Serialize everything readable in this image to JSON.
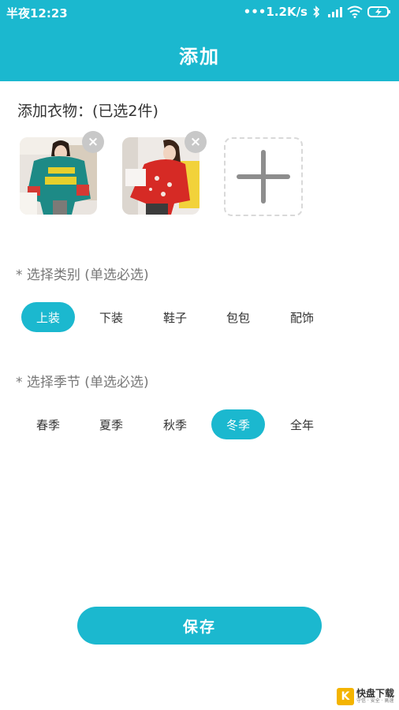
{
  "status_bar": {
    "time": "半夜12:23",
    "network_speed": "•••1.2K/s",
    "icons": [
      "bluetooth-icon",
      "hd-signal-icon",
      "wifi-icon",
      "battery-charging-icon"
    ]
  },
  "header": {
    "title": "添加"
  },
  "photos": {
    "section_title": "添加衣物：(已选2件)",
    "items": [
      {
        "alt": "green letter sweater photo",
        "remove_label": "×"
      },
      {
        "alt": "red floral sweater photo",
        "remove_label": "×"
      }
    ],
    "add_icon": "plus-icon"
  },
  "category": {
    "label": "* 选择类别 (单选必选)",
    "options": [
      "上装",
      "下装",
      "鞋子",
      "包包",
      "配饰"
    ],
    "selected": "上装"
  },
  "season": {
    "label": "* 选择季节 (单选必选)",
    "options": [
      "春季",
      "夏季",
      "秋季",
      "冬季",
      "全年"
    ],
    "selected": "冬季"
  },
  "actions": {
    "save_label": "保存"
  },
  "watermark": {
    "mark": "K",
    "title": "快盘下载",
    "subtitle": "守信 · 安全 · 高速"
  },
  "colors": {
    "accent": "#1bb8cf",
    "chip_active_text": "#ffffff"
  }
}
